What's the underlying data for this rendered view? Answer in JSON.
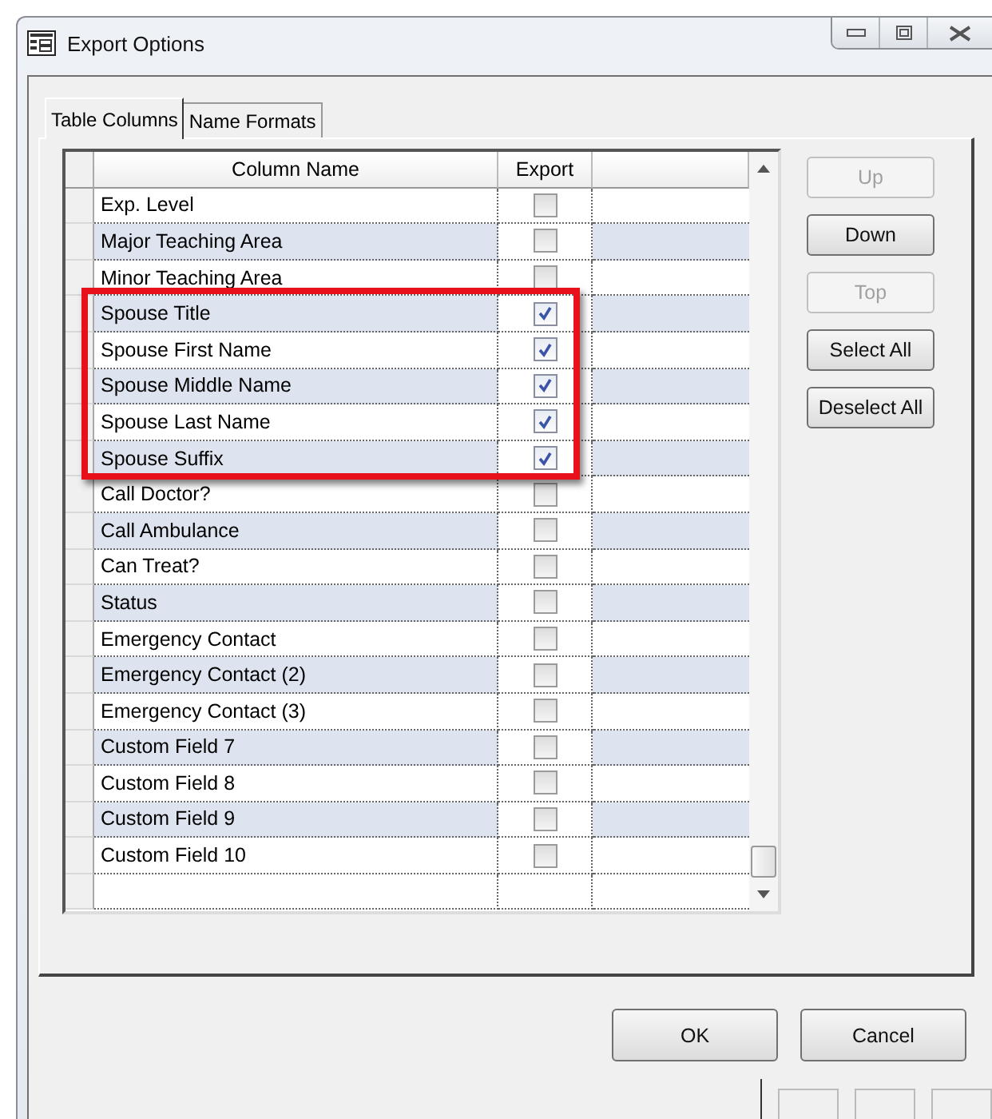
{
  "window": {
    "title": "Export Options"
  },
  "tabs": [
    {
      "label": "Table Columns",
      "selected": true
    },
    {
      "label": "Name Formats",
      "selected": false
    }
  ],
  "table": {
    "columns": [
      "Column Name",
      "Export"
    ],
    "rows": [
      {
        "name": "Exp. Level",
        "checked": false
      },
      {
        "name": "Major Teaching Area",
        "checked": false
      },
      {
        "name": "Minor Teaching Area",
        "checked": false
      },
      {
        "name": "Spouse Title",
        "checked": true
      },
      {
        "name": "Spouse First Name",
        "checked": true
      },
      {
        "name": "Spouse Middle Name",
        "checked": true
      },
      {
        "name": "Spouse Last Name",
        "checked": true
      },
      {
        "name": "Spouse Suffix",
        "checked": true
      },
      {
        "name": "Call Doctor?",
        "checked": false
      },
      {
        "name": "Call Ambulance",
        "checked": false
      },
      {
        "name": "Can Treat?",
        "checked": false
      },
      {
        "name": "Status",
        "checked": false
      },
      {
        "name": "Emergency Contact",
        "checked": false
      },
      {
        "name": "Emergency Contact (2)",
        "checked": false
      },
      {
        "name": "Emergency Contact (3)",
        "checked": false
      },
      {
        "name": "Custom Field 7",
        "checked": false
      },
      {
        "name": "Custom Field 8",
        "checked": false
      },
      {
        "name": "Custom Field 9",
        "checked": false
      },
      {
        "name": "Custom Field 10",
        "checked": false
      }
    ]
  },
  "side_buttons": [
    {
      "label": "Up",
      "disabled": true
    },
    {
      "label": "Down",
      "disabled": false
    },
    {
      "label": "Top",
      "disabled": true
    },
    {
      "label": "Select All",
      "disabled": false
    },
    {
      "label": "Deselect All",
      "disabled": false
    }
  ],
  "buttons": [
    {
      "label": "OK"
    },
    {
      "label": "Cancel"
    }
  ]
}
